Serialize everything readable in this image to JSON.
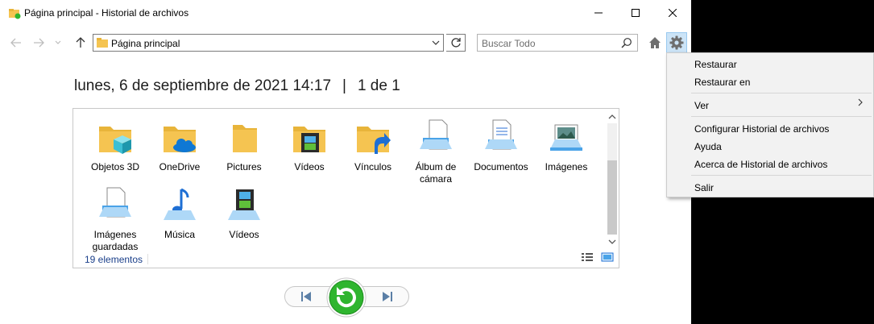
{
  "window": {
    "title": "Página principal - Historial de archivos"
  },
  "toolbar": {
    "address": "Página principal",
    "search_placeholder": "Buscar Todo"
  },
  "header": {
    "datetime": "lunes, 6 de septiembre de 2021 14:17",
    "separator": "|",
    "page_info": "1 de 1"
  },
  "items": [
    {
      "label": "Objetos 3D",
      "icon": "folder-3d-objects-icon"
    },
    {
      "label": "OneDrive",
      "icon": "folder-onedrive-icon"
    },
    {
      "label": "Pictures",
      "icon": "folder-icon"
    },
    {
      "label": "Vídeos",
      "icon": "folder-videos-icon"
    },
    {
      "label": "Vínculos",
      "icon": "folder-links-icon"
    },
    {
      "label": "Álbum de cámara",
      "icon": "camera-roll-icon"
    },
    {
      "label": "Documentos",
      "icon": "documents-icon"
    },
    {
      "label": "Imágenes",
      "icon": "pictures-icon"
    },
    {
      "label": "Imágenes guardadas",
      "icon": "saved-pictures-icon"
    },
    {
      "label": "Música",
      "icon": "music-icon"
    },
    {
      "label": "Vídeos",
      "icon": "videos-icon"
    }
  ],
  "status": {
    "count": "19 elementos"
  },
  "menu": {
    "items": [
      {
        "label": "Restaurar"
      },
      {
        "label": "Restaurar en"
      },
      {
        "label": "Ver"
      },
      {
        "label": "Configurar Historial de archivos"
      },
      {
        "label": "Ayuda"
      },
      {
        "label": "Acerca de Historial de archivos"
      },
      {
        "label": "Salir"
      }
    ]
  },
  "colors": {
    "accent": "#cce4f7",
    "restore_green": "#2fb52f",
    "status_text": "#1a3f8a",
    "folder_yellow": "#f5c451"
  }
}
